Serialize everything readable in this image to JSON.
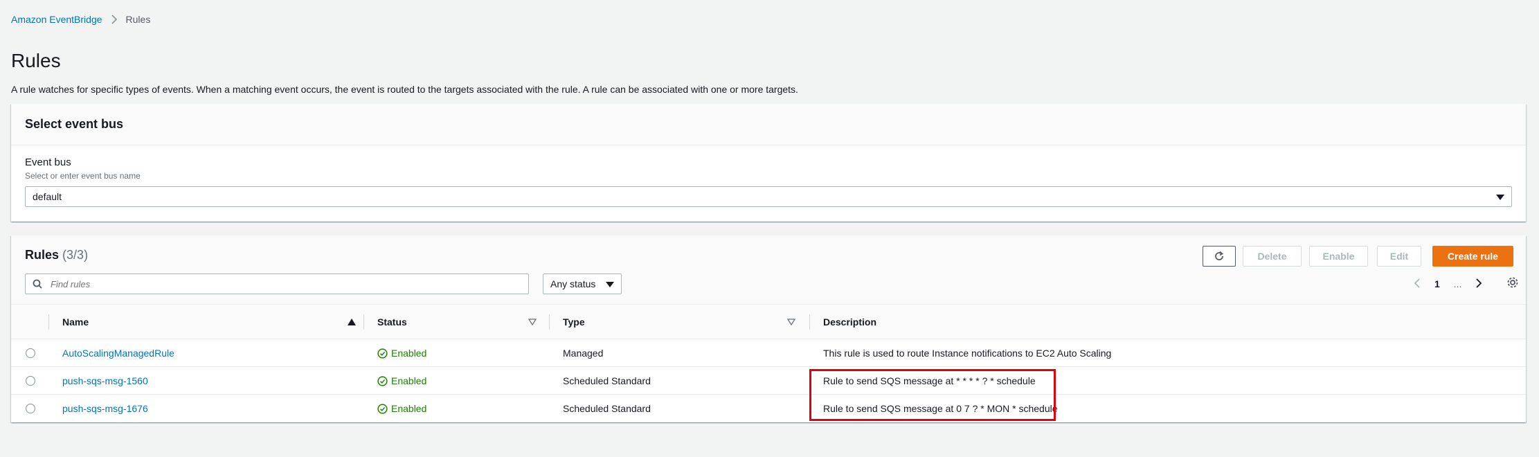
{
  "breadcrumb": {
    "root": "Amazon EventBridge",
    "current": "Rules"
  },
  "page": {
    "title": "Rules",
    "description": "A rule watches for specific types of events. When a matching event occurs, the event is routed to the targets associated with the rule. A rule can be associated with one or more targets."
  },
  "event_bus_panel": {
    "header": "Select event bus",
    "label": "Event bus",
    "hint": "Select or enter event bus name",
    "value": "default"
  },
  "rules_panel": {
    "title": "Rules",
    "count": "(3/3)",
    "buttons": {
      "delete": "Delete",
      "enable": "Enable",
      "edit": "Edit",
      "create": "Create rule"
    },
    "search_placeholder": "Find rules",
    "status_filter": "Any status",
    "pagination": {
      "current_page": "1",
      "ellipsis": "..."
    },
    "columns": {
      "name": "Name",
      "status": "Status",
      "type": "Type",
      "description": "Description"
    },
    "rows": [
      {
        "name": "AutoScalingManagedRule",
        "status": "Enabled",
        "type": "Managed",
        "description": "This rule is used to route Instance notifications to EC2 Auto Scaling"
      },
      {
        "name": "push-sqs-msg-1560",
        "status": "Enabled",
        "type": "Scheduled Standard",
        "description": "Rule to send SQS message at * * * * ? * schedule"
      },
      {
        "name": "push-sqs-msg-1676",
        "status": "Enabled",
        "type": "Scheduled Standard",
        "description": "Rule to send SQS message at 0 7 ? * MON * schedule"
      }
    ]
  },
  "colors": {
    "link": "#0073bb",
    "primary_button": "#ec7211",
    "status_enabled": "#1d8102",
    "highlight": "#e3000f"
  }
}
